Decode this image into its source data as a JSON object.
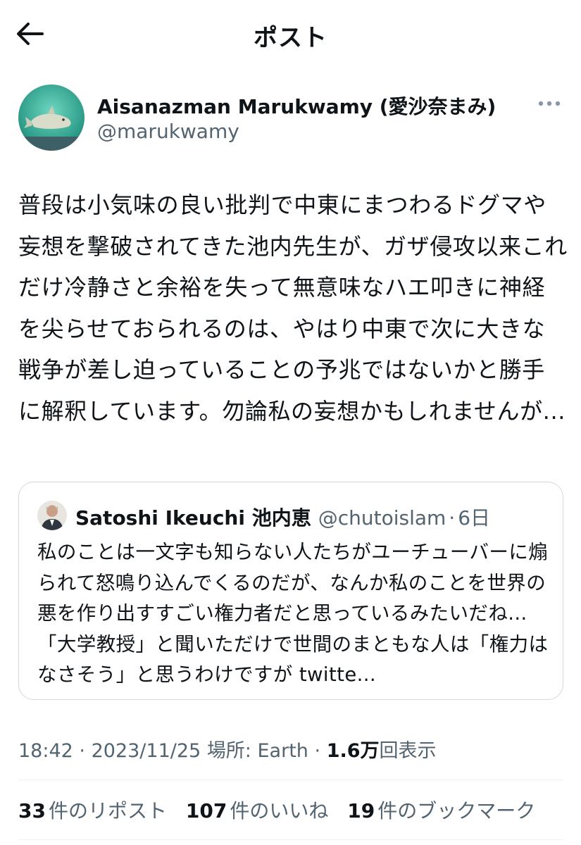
{
  "header": {
    "title": "ポスト",
    "back_icon": "arrow-left-icon"
  },
  "author": {
    "name": "Aisanazman Marukwamy (愛沙奈まみ)",
    "handle": "@marukwamy",
    "avatar_icon": "orca-avatar",
    "more_icon": "more-horizontal-icon"
  },
  "post": {
    "text": "普段は小気味の良い批判で中東にまつわるドグマや妄想を撃破されてきた池内先生が、ガザ侵攻以来これだけ冷静さと余裕を失って無意味なハエ叩きに神経を尖らせておられるのは、やはり中東で次に大きな戦争が差し迫っていることの予兆ではないかと勝手に解釈しています。勿論私の妄想かもしれませんが..."
  },
  "quote": {
    "name": "Satoshi Ikeuchi 池内恵",
    "handle": "@chutoislam",
    "separator": "·",
    "time": "6日",
    "text": "私のことは一文字も知らない人たちがユーチューバーに煽られて怒鳴り込んでくるのだが、なんか私のことを世界の悪を作り出すすごい権力者だと思っているみたいだね...「大学教授」と聞いただけで世間のまともな人は「権力はなさそう」と思うわけですが twitte..."
  },
  "meta": {
    "time": "18:42",
    "sep1": "·",
    "date": "2023/11/25",
    "location": "場所: Earth",
    "sep2": "·",
    "views_count": "1.6万",
    "views_label": "回表示"
  },
  "stats": {
    "reposts_count": "33",
    "reposts_label": "件のリポスト",
    "likes_count": "107",
    "likes_label": "件のいいね",
    "bookmarks_count": "19",
    "bookmarks_label": "件のブックマーク"
  },
  "colors": {
    "text": "#0f1419",
    "secondary": "#536471",
    "border": "#cfd9de",
    "divider": "#eff3f4"
  }
}
